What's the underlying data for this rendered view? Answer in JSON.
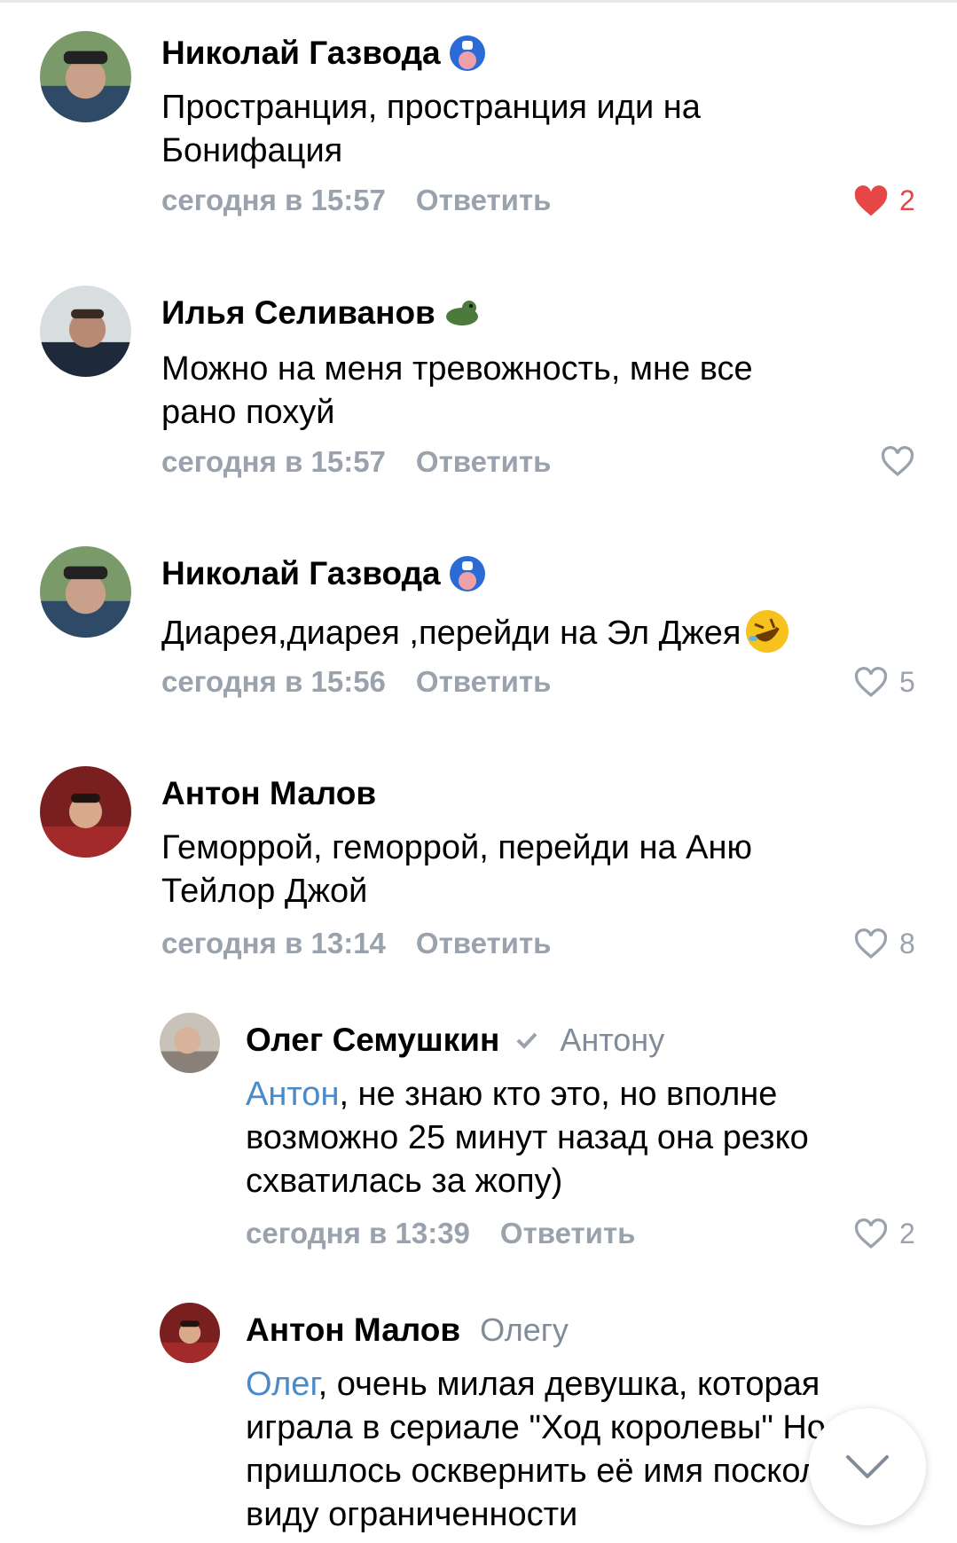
{
  "comments": [
    {
      "author": "Николай Газвода",
      "badge": "captain-shield-emoji",
      "text": "Пространция, пространция иди на Бонифация",
      "time": "сегодня в 15:57",
      "reply_label": "Ответить",
      "likes": "2",
      "liked": true
    },
    {
      "author": "Илья Селиванов",
      "badge": "lizard-emoji",
      "text": "Можно на меня тревожность, мне все рано похуй",
      "time": "сегодня в 15:57",
      "reply_label": "Ответить",
      "likes": "",
      "liked": false
    },
    {
      "author": "Николай Газвода",
      "badge": "captain-shield-emoji",
      "text": "Диарея,диарея ,перейди на Эл Джея",
      "text_emoji": "rolling-laughing-emoji",
      "time": "сегодня в 15:56",
      "reply_label": "Ответить",
      "likes": "5",
      "liked": false
    },
    {
      "author": "Антон Малов",
      "text": "Геморрой, геморрой, перейди на Аню Тейлор Джой",
      "time": "сегодня в 13:14",
      "reply_label": "Ответить",
      "likes": "8",
      "liked": false
    },
    {
      "author": "Олег Семушкин",
      "verified": true,
      "reply_to": "Антону",
      "mention": "Антон",
      "text": ", не знаю кто это, но вполне возможно 25 минут назад она резко схватилась за жопу)",
      "time": "сегодня в 13:39",
      "reply_label": "Ответить",
      "likes": "2",
      "liked": false
    },
    {
      "author": "Антон Малов",
      "reply_to": "Олегу",
      "mention": "Олег",
      "text": ", очень милая девушка, которая играла в сериале \"Ход королевы\" Но пришлось осквернить её имя поскольку в виду ограниченности",
      "time": "",
      "reply_label": "",
      "likes": "",
      "liked": false
    }
  ],
  "colors": {
    "meta": "#99a2ad",
    "mention": "#4a8ac9",
    "like_active": "#e64646"
  },
  "scroll_button": {
    "icon": "chevron-down-icon"
  }
}
